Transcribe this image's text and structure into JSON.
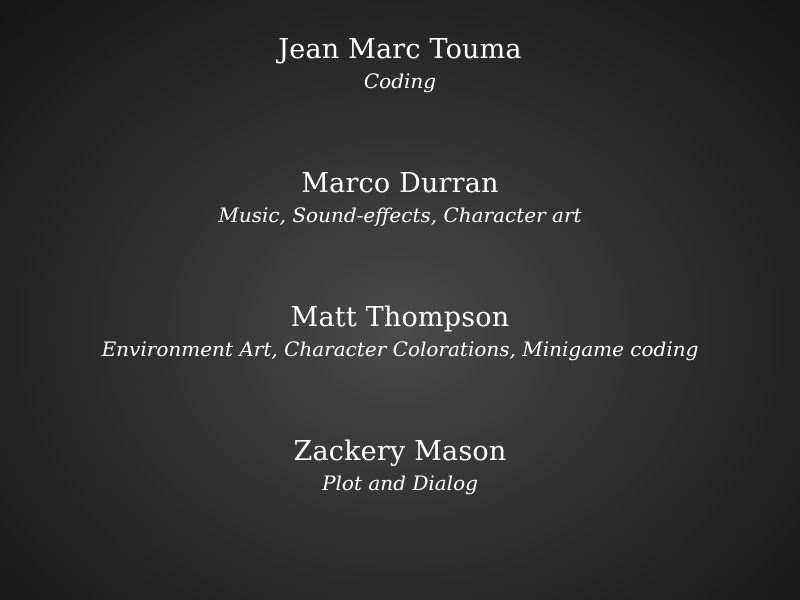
{
  "credits": [
    {
      "name": "Jean Marc Touma",
      "role": "Coding"
    },
    {
      "name": "Marco Durran",
      "role": "Music, Sound-effects, Character art"
    },
    {
      "name": "Matt Thompson",
      "role": "Environment Art, Character Colorations, Minigame coding"
    },
    {
      "name": "Zackery Mason",
      "role": "Plot and Dialog"
    }
  ],
  "colors": {
    "text": "#ffffff",
    "background_center": "#4a4a4a",
    "background_edge": "#151515"
  }
}
